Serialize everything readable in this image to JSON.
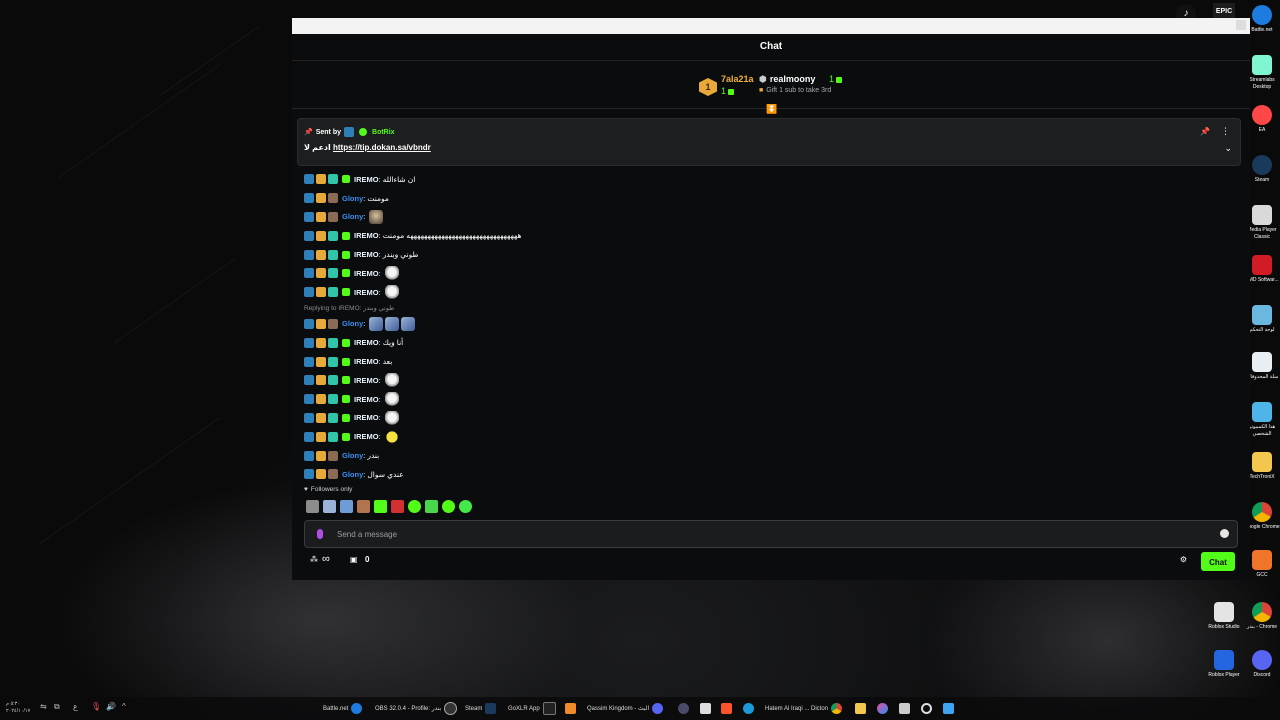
{
  "window": {
    "title": "Chat"
  },
  "leaderboard": {
    "rank": "1",
    "first": {
      "name": "7ala21a",
      "count": "1"
    },
    "second": {
      "name": "realmoony",
      "count": "1",
      "note": "Gift 1 sub to take 3rd"
    }
  },
  "pinned": {
    "sent_by": "Sent by",
    "author": "BotRix",
    "prefix": "ادعم لا",
    "link": "https://tip.dokan.sa/vbndr"
  },
  "messages": [
    {
      "user": "IREMO",
      "text": "ان شاءالله"
    },
    {
      "user": "Glony",
      "text": "مومنت"
    },
    {
      "user": "Glony",
      "text": ""
    },
    {
      "user": "IREMO",
      "text": "ههههههههههههههههههههههههههههههههه مومنت"
    },
    {
      "user": "IREMO",
      "text": "طوني وبندر"
    },
    {
      "user": "IREMO",
      "text": ""
    },
    {
      "user": "IREMO",
      "text": ""
    },
    {
      "user": "Glony",
      "text": "",
      "reply": "Replying to IREMO: طوني وبندر"
    },
    {
      "user": "IREMO",
      "text": "أنا ويك"
    },
    {
      "user": "IREMO",
      "text": "بعد"
    },
    {
      "user": "IREMO",
      "text": ""
    },
    {
      "user": "IREMO",
      "text": ""
    },
    {
      "user": "IREMO",
      "text": ""
    },
    {
      "user": "IREMO",
      "text": ""
    },
    {
      "user": "Glony",
      "text": "بندر"
    },
    {
      "user": "Glony",
      "text": "عندي سوال"
    }
  ],
  "chat_mode": "Followers only",
  "input": {
    "placeholder": "Send a message"
  },
  "footer": {
    "points": "∞",
    "gifts": "0",
    "send_label": "Chat"
  },
  "taskbar": {
    "time": "٥:٣٠ م",
    "date": "٢٠٢٤/١٠/١٧",
    "items": [
      "Battle.net",
      "OBS 32.0.4 - Profile: بندر",
      "Steam",
      "GoXLR App",
      "Qassim Kingdom - البث",
      "Hatem Al Iraqi ... Dicton"
    ]
  },
  "desktop_icons": [
    "Battle.net",
    "Streamlabs Desktop",
    "EA",
    "Steam",
    "Media Player Classic",
    "AMD Softwar...",
    "لوحة التحكم",
    "سلة المحذوفات",
    "هذا الكمبيوتر الشخصي",
    "TechTroniX",
    "Google Chrome",
    "GCC",
    "Roblox Studio",
    "بندر - Chrome",
    "Roblox Player",
    "Discord"
  ],
  "top_icons": [
    "TikTok",
    "EPIC"
  ]
}
